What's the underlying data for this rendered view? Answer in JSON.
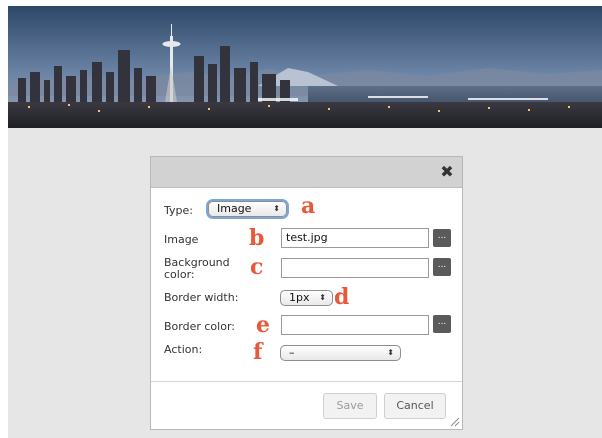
{
  "banner": {
    "alt": "Seattle skyline panorama"
  },
  "dialog": {
    "close_glyph": "✖",
    "rows": {
      "type": {
        "label": "Type:",
        "value": "Image",
        "callout": "a"
      },
      "image": {
        "label": "Image",
        "value": "test.jpg",
        "callout": "b",
        "browse": "..."
      },
      "bgcolor": {
        "label_line1": "Background",
        "label_line2": "color:",
        "value": "",
        "callout": "c",
        "browse": "..."
      },
      "border_width": {
        "label": "Border width:",
        "value": "1px",
        "callout": "d"
      },
      "border_color": {
        "label": "Border color:",
        "value": "",
        "callout": "e",
        "browse": "..."
      },
      "action": {
        "label": "Action:",
        "value": "–",
        "callout": "f"
      }
    },
    "buttons": {
      "save": "Save",
      "cancel": "Cancel"
    }
  },
  "colors": {
    "callout": "#e8583b",
    "header": "#d2d2d2",
    "page_bg": "#e6e6e6"
  }
}
